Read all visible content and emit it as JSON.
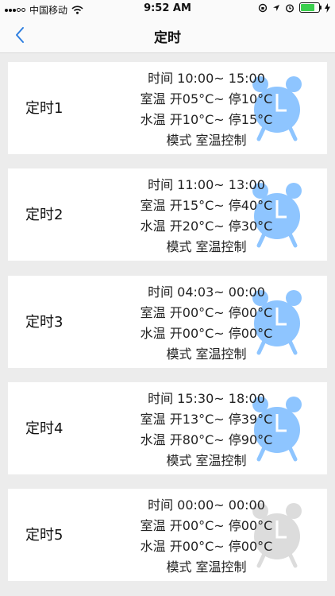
{
  "status_bar": {
    "carrier": "中国移动",
    "time": "9:52 AM",
    "battery_level": 0.85,
    "colors": {
      "battery": "#3bcf4e"
    }
  },
  "nav": {
    "title": "定时",
    "back_icon": "chevron-left-icon",
    "accent": "#2f7fe0"
  },
  "timers": [
    {
      "label": "定时1",
      "time": "时间 10:00~ 15:00",
      "room": "室温 开05°C~ 停10°C",
      "water": "水温 开10°C~ 停15°C",
      "mode": "模式 室温控制",
      "enabled": true
    },
    {
      "label": "定时2",
      "time": "时间 11:00~ 13:00",
      "room": "室温 开15°C~ 停40°C",
      "water": "水温 开20°C~ 停30°C",
      "mode": "模式 室温控制",
      "enabled": true
    },
    {
      "label": "定时3",
      "time": "时间 04:03~ 00:00",
      "room": "室温 开00°C~ 停00°C",
      "water": "水温 开00°C~ 停00°C",
      "mode": "模式 室温控制",
      "enabled": true
    },
    {
      "label": "定时4",
      "time": "时间 15:30~ 18:00",
      "room": "室温 开13°C~ 停39°C",
      "water": "水温 开80°C~ 停90°C",
      "mode": "模式 室温控制",
      "enabled": true
    },
    {
      "label": "定时5",
      "time": "时间 00:00~ 00:00",
      "room": "室温 开00°C~ 停00°C",
      "water": "水温 开00°C~ 停00°C",
      "mode": "模式 室温控制",
      "enabled": false
    }
  ],
  "clock_colors": {
    "enabled": "#8ec5ff",
    "disabled": "#dcdcdc"
  }
}
